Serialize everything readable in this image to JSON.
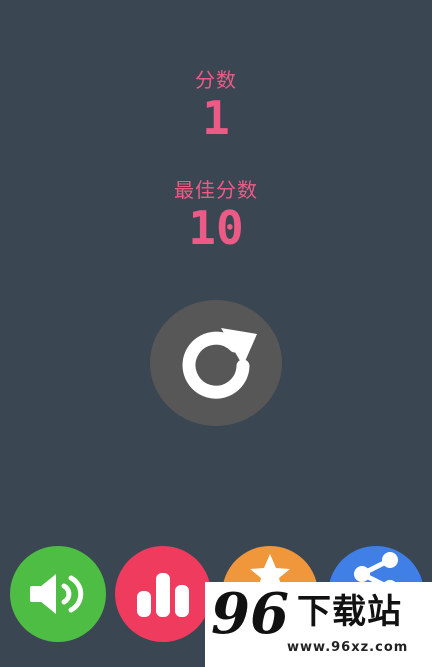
{
  "score": {
    "label": "分数",
    "value": "1"
  },
  "best": {
    "label": "最佳分数",
    "value": "10"
  },
  "buttons": {
    "restart": {
      "icon": "restart-icon",
      "color": "#575757"
    },
    "sound": {
      "icon": "speaker-icon",
      "color": "#4dbd43"
    },
    "leaderboard": {
      "icon": "bar-chart-icon",
      "color": "#ee3b5e"
    },
    "rate": {
      "icon": "star-icon",
      "color": "#f0973b"
    },
    "share": {
      "icon": "share-icon",
      "color": "#3f7fe6"
    }
  },
  "watermark": {
    "number": "96",
    "text": "下载站",
    "url": "www.96xz.com"
  },
  "colors": {
    "background": "#3b4653",
    "accent": "#ec5b86"
  }
}
